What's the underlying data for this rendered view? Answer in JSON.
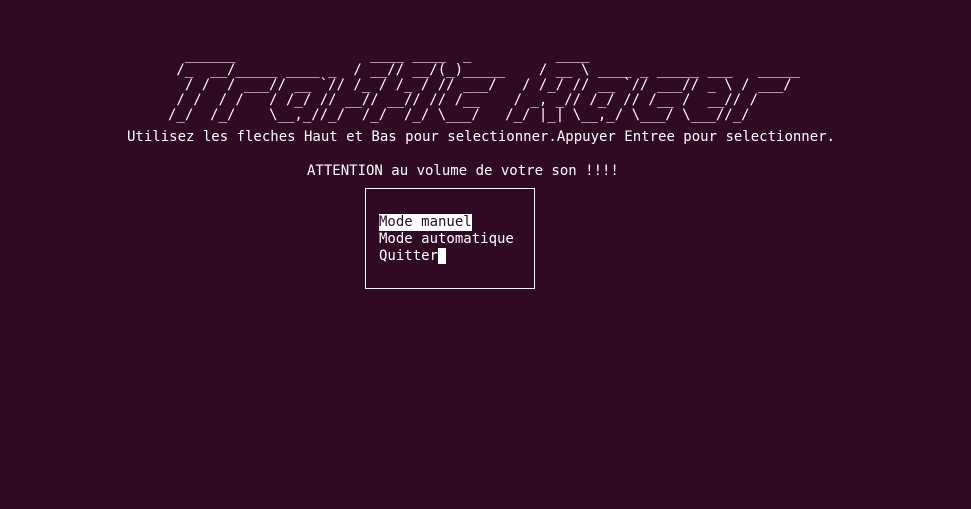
{
  "terminal": {
    "background": "#300a24",
    "foreground": "#ffffff"
  },
  "banner": {
    "art": "  ______                ____ ____  _          ____\n /_  __/_____ ____ _  / __// __/(_)_____    / __ \\ ____ _ _____ ___   _____\n  / /  / ___// __ `// /_ / /_ / // ___/   / /_/ // __ `// ___// _ \\ / ___/\n / /  / /   / /_/ // __// __// // /__    / _, _// /_/ // /__ /  __// /\n/_/  /_/    \\__,_//_/  /_/  /_/ \\___/   /_/ |_| \\__,_/ \\___/ \\___//_/"
  },
  "instructions": "Utilisez les fleches Haut et Bas pour selectionner.Appuyer Entree pour selectionner.",
  "warning": "ATTENTION au volume de votre son !!!!",
  "menu": {
    "items": [
      {
        "label": "Mode manuel",
        "selected": true
      },
      {
        "label": "Mode automatique",
        "selected": false
      },
      {
        "label": "Quitter",
        "selected": false
      }
    ]
  }
}
